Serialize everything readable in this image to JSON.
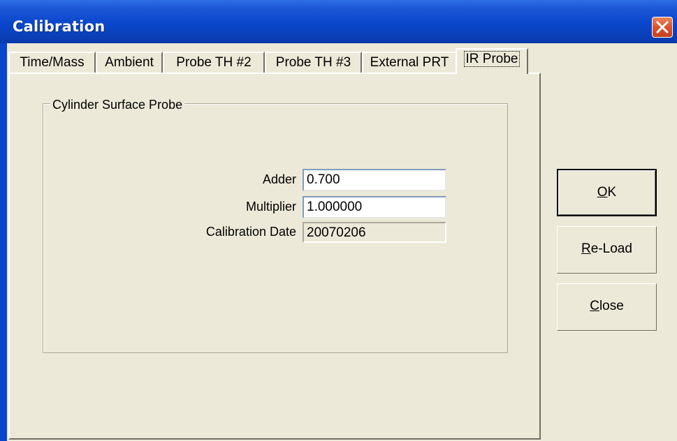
{
  "window": {
    "title": "Calibration"
  },
  "tabs": [
    {
      "label": "Time/Mass",
      "active": false
    },
    {
      "label": "Ambient",
      "active": false
    },
    {
      "label": "Probe TH #2",
      "active": false
    },
    {
      "label": "Probe TH #3",
      "active": false
    },
    {
      "label": "External PRT",
      "active": false
    },
    {
      "label": "IR Probe",
      "active": true
    }
  ],
  "group": {
    "title": "Cylinder Surface Probe",
    "fields": {
      "adder": {
        "label": "Adder",
        "value": "0.700"
      },
      "multiplier": {
        "label": "Multiplier",
        "value": "1.000000"
      },
      "calibration_date": {
        "label": "Calibration Date",
        "value": "20070206",
        "readonly": true
      }
    }
  },
  "buttons": {
    "ok": {
      "mnemonic": "O",
      "rest": "K"
    },
    "reload": {
      "mnemonic": "R",
      "rest": "e-Load"
    },
    "close": {
      "mnemonic": "C",
      "rest": "lose"
    }
  },
  "icons": {
    "close": "close-x-icon"
  }
}
